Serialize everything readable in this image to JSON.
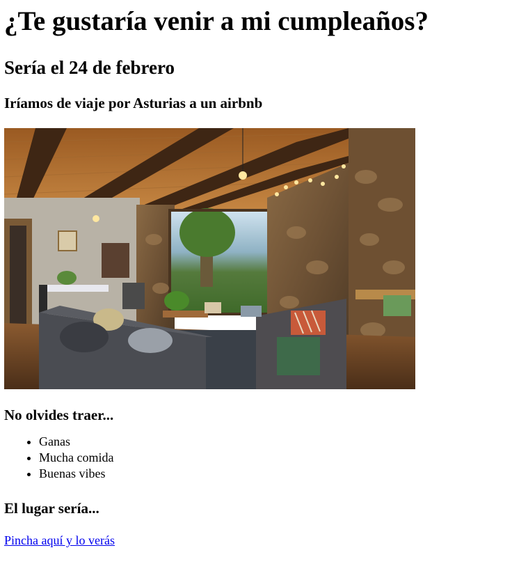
{
  "heading": "¿Te gustaría venir a mi cumpleaños?",
  "date_heading": "Sería el 24 de febrero",
  "trip_heading": "Iríamos de viaje por Asturias a un airbnb",
  "bring_heading": "No olvides traer...",
  "bring_items": [
    "Ganas",
    "Mucha comida",
    "Buenas vibes"
  ],
  "place_heading": "El lugar sería...",
  "place_link": "Pincha aquí y lo verás",
  "colors": {
    "link": "#0000ee",
    "text": "#000000",
    "background": "#ffffff"
  }
}
